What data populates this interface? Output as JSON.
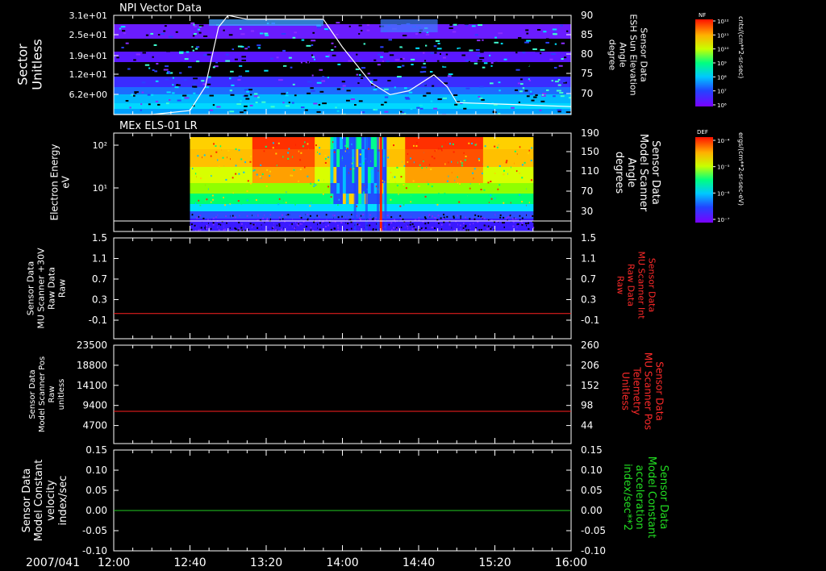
{
  "date_label": "2007/041",
  "time_ticks": [
    "12:00",
    "12:40",
    "13:20",
    "14:00",
    "14:40",
    "15:20",
    "16:00"
  ],
  "colors": {
    "background": "#000000",
    "axis": "#ffffff",
    "line_white": "#ffffff",
    "line_red": "#ff2020",
    "line_green": "#22cc22",
    "label_red": "#ff2a2a",
    "label_green": "#22dd22"
  },
  "colorbars": [
    {
      "tag": "NF",
      "unit": "cnts/(cm**2-sr-sec)",
      "tick_labels": [
        "10¹²",
        "10¹¹",
        "10¹⁰",
        "10⁹",
        "10⁸",
        "10⁷",
        "10⁶"
      ],
      "scale": "log"
    },
    {
      "tag": "DEF",
      "unit": "ergs/(cm**2-sr-sec-eV)",
      "tick_labels": [
        "10⁻⁴",
        "10⁻⁵",
        "10⁻⁶",
        "10⁻⁷"
      ],
      "scale": "log"
    }
  ],
  "chart_data": [
    {
      "type": "heatmap",
      "title": "NPI Vector Data",
      "ylabel_left": [
        "Sector",
        "Unitless"
      ],
      "yticks_left": [
        "3.1e+01",
        "2.5e+01",
        "1.9e+01",
        "1.2e+01",
        "6.2e+00"
      ],
      "ylabel_right": [
        "Sensor Data",
        "ESH Sun Elevation",
        "Angle",
        "degree"
      ],
      "yticks_right": [
        "90",
        "85",
        "80",
        "75",
        "70"
      ],
      "ylim_right": [
        65,
        90
      ],
      "overlay_series": {
        "color": "white",
        "points": [
          {
            "t": "12:00",
            "v": 65
          },
          {
            "t": "12:20",
            "v": 65
          },
          {
            "t": "12:40",
            "v": 66
          },
          {
            "t": "12:48",
            "v": 72
          },
          {
            "t": "12:55",
            "v": 87
          },
          {
            "t": "13:00",
            "v": 90
          },
          {
            "t": "13:10",
            "v": 89
          },
          {
            "t": "13:50",
            "v": 89
          },
          {
            "t": "14:00",
            "v": 82
          },
          {
            "t": "14:15",
            "v": 73
          },
          {
            "t": "14:25",
            "v": 70
          },
          {
            "t": "14:35",
            "v": 71
          },
          {
            "t": "14:48",
            "v": 75
          },
          {
            "t": "14:55",
            "v": 72
          },
          {
            "t": "15:00",
            "v": 68
          },
          {
            "t": "16:00",
            "v": 67
          }
        ]
      }
    },
    {
      "type": "heatmap",
      "title": "MEx ELS-01 LR",
      "ylabel_left": [
        "Electron Energy",
        "eV"
      ],
      "yticks_left": [
        "10²",
        "10¹"
      ],
      "ylabel_right": [
        "Sensor Data",
        "Model Scanner",
        "Angle",
        "degrees"
      ],
      "yticks_right": [
        "190",
        "150",
        "110",
        "70",
        "30"
      ],
      "ylim_right": [
        0,
        190
      ],
      "data_span": [
        "12:40",
        "15:40"
      ],
      "overlay_series": {
        "color": "white",
        "constant": 0
      }
    },
    {
      "type": "line",
      "ylabel_left": [
        "Sensor Data",
        "MU Scanner +30V",
        "Raw Data",
        "Raw"
      ],
      "yticks_left": [
        "1.5",
        "1.1",
        "0.7",
        "0.3",
        "-0.1"
      ],
      "ylim_left": [
        -0.5,
        1.5
      ],
      "ylabel_right": [
        "Sensor Data",
        "MU Scanner Int",
        "Raw Data",
        "Raw"
      ],
      "yticks_right": [
        "1.5",
        "1.1",
        "0.7",
        "0.3",
        "-0.1"
      ],
      "series": [
        {
          "color": "red",
          "constant": 0.0
        }
      ]
    },
    {
      "type": "line",
      "ylabel_left": [
        "Sensor Data",
        "Model Scanner Pos",
        "Raw",
        "unitless"
      ],
      "yticks_left": [
        "23500",
        "18800",
        "14100",
        "9400",
        "4700"
      ],
      "ylim_left": [
        0,
        23500
      ],
      "ylabel_right": [
        "Sensor Data",
        "MU Scanner Pos",
        "Telemetry",
        "Unitless"
      ],
      "yticks_right": [
        "260",
        "206",
        "152",
        "98",
        "44"
      ],
      "series": [
        {
          "color": "red",
          "constant": 7700
        }
      ]
    },
    {
      "type": "line",
      "ylabel_left": [
        "Sensor Data",
        "Model Constant",
        "velocity",
        "index/sec"
      ],
      "yticks_left": [
        "0.15",
        "0.10",
        "0.05",
        "0.00",
        "-0.05",
        "-0.10"
      ],
      "ylim_left": [
        -0.1,
        0.15
      ],
      "ylabel_right": [
        "Sensor Data",
        "Model Constant",
        "acceleration",
        "index/sec**2"
      ],
      "yticks_right": [
        "0.15",
        "0.10",
        "0.05",
        "0.00",
        "-0.05",
        "-0.10"
      ],
      "series": [
        {
          "color": "green",
          "constant": 0.0
        }
      ]
    }
  ]
}
